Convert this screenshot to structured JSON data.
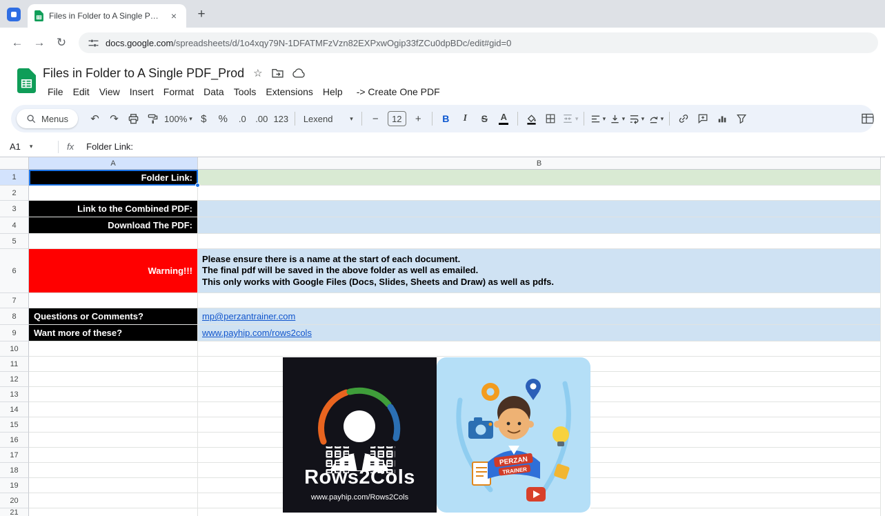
{
  "colors": {
    "black_cell": "#000000",
    "red_cell": "#ff0000",
    "light_blue_cell": "#cfe2f3",
    "light_green_cell": "#d9ead3",
    "link": "#1155cc",
    "selection": "#1a73e8",
    "sheets_green": "#0f9d58"
  },
  "browser": {
    "tab_title": "Files in Folder to A Single PDF_",
    "url_host": "docs.google.com",
    "url_path": "/spreadsheets/d/1o4xqy79N-1DFATMFzVzn82EXPxwOgip33fZCu0dpBDc/edit#gid=0"
  },
  "header": {
    "title": "Files in Folder to A Single PDF_Prod",
    "menus": [
      "File",
      "Edit",
      "View",
      "Insert",
      "Format",
      "Data",
      "Tools",
      "Extensions",
      "Help",
      "-> Create One PDF"
    ]
  },
  "toolbar": {
    "menus_label": "Menus",
    "zoom": "100%",
    "currency": "$",
    "percent": "%",
    "decrease_decimal": ".0",
    "increase_decimal": ".00",
    "number_format": "123",
    "font": "Lexend",
    "font_size": "12",
    "bold": "B",
    "italic": "I",
    "strikethrough": "S",
    "text_color": "A"
  },
  "formula_bar": {
    "cell_ref": "A1",
    "fx": "fx",
    "value": "Folder Link:"
  },
  "grid": {
    "col_headers": [
      "A",
      "B"
    ],
    "rows": [
      {
        "num": "1",
        "a": "Folder Link:"
      },
      {
        "num": "2"
      },
      {
        "num": "3",
        "a": "Link to the Combined PDF:"
      },
      {
        "num": "4",
        "a": "Download The PDF:"
      },
      {
        "num": "5"
      },
      {
        "num": "6",
        "a": "Warning!!!",
        "b_lines": [
          "Please ensure there is a name at the start of each document.",
          "The final pdf will be saved in the above folder as well as emailed.",
          "This only works with Google Files (Docs, Slides, Sheets and Draw) as well as pdfs."
        ]
      },
      {
        "num": "7"
      },
      {
        "num": "8",
        "a": "Questions or Comments?",
        "b": "mp@perzantrainer.com"
      },
      {
        "num": "9",
        "a": "Want more of these?",
        "b": "www.payhip.com/rows2cols"
      },
      {
        "num": "10"
      },
      {
        "num": "11"
      },
      {
        "num": "12"
      },
      {
        "num": "13"
      },
      {
        "num": "14"
      },
      {
        "num": "15"
      },
      {
        "num": "16"
      },
      {
        "num": "17"
      },
      {
        "num": "18"
      },
      {
        "num": "19"
      },
      {
        "num": "20"
      },
      {
        "num": "21"
      }
    ]
  },
  "images": {
    "rows2cols": {
      "title": "Rows2Cols",
      "subtitle": "www.payhip.com/Rows2Cols"
    },
    "perzan": {
      "badge_top": "PERZAN",
      "badge_bottom": "TRAINER"
    }
  },
  "icons": {
    "caret": "▾",
    "undo": "↶",
    "redo": "↷",
    "close": "×",
    "new_tab": "+",
    "star": "☆",
    "minus": "−",
    "plus": "+",
    "back": "←",
    "forward": "→",
    "reload": "↻"
  }
}
